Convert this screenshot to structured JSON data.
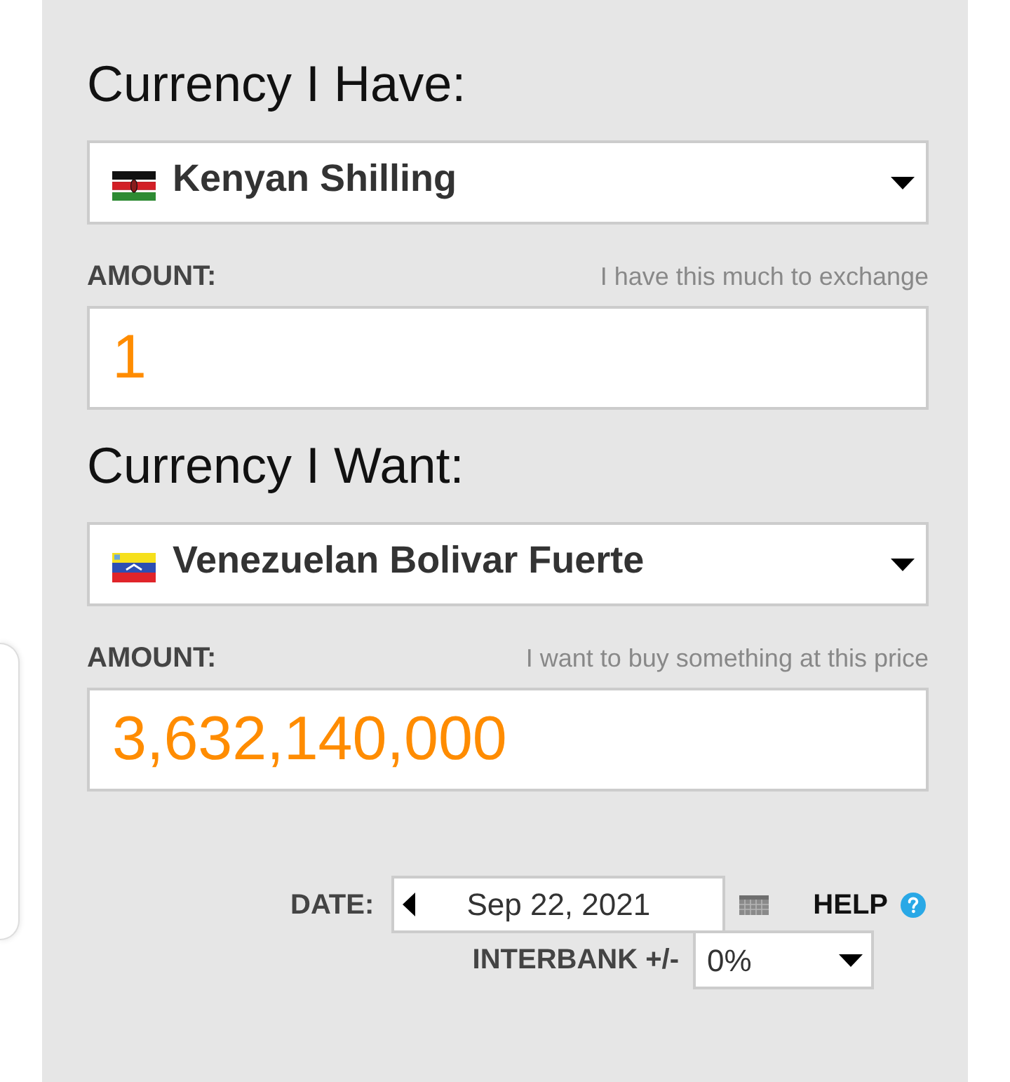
{
  "sections": [
    {
      "heading": "Currency I Have:",
      "currency": "Kenyan Shilling",
      "amount_label": "AMOUNT:",
      "amount_hint": "I have this much to exchange",
      "amount_value": "1"
    },
    {
      "heading": "Currency I Want:",
      "currency": "Venezuelan Bolivar Fuerte",
      "amount_label": "AMOUNT:",
      "amount_hint": "I want to buy something at this price",
      "amount_value": "3,632,140,000"
    }
  ],
  "date": {
    "label": "DATE:",
    "value": "Sep 22, 2021"
  },
  "help": {
    "label": "HELP"
  },
  "interbank": {
    "label": "INTERBANK +/-",
    "value": "0%"
  }
}
